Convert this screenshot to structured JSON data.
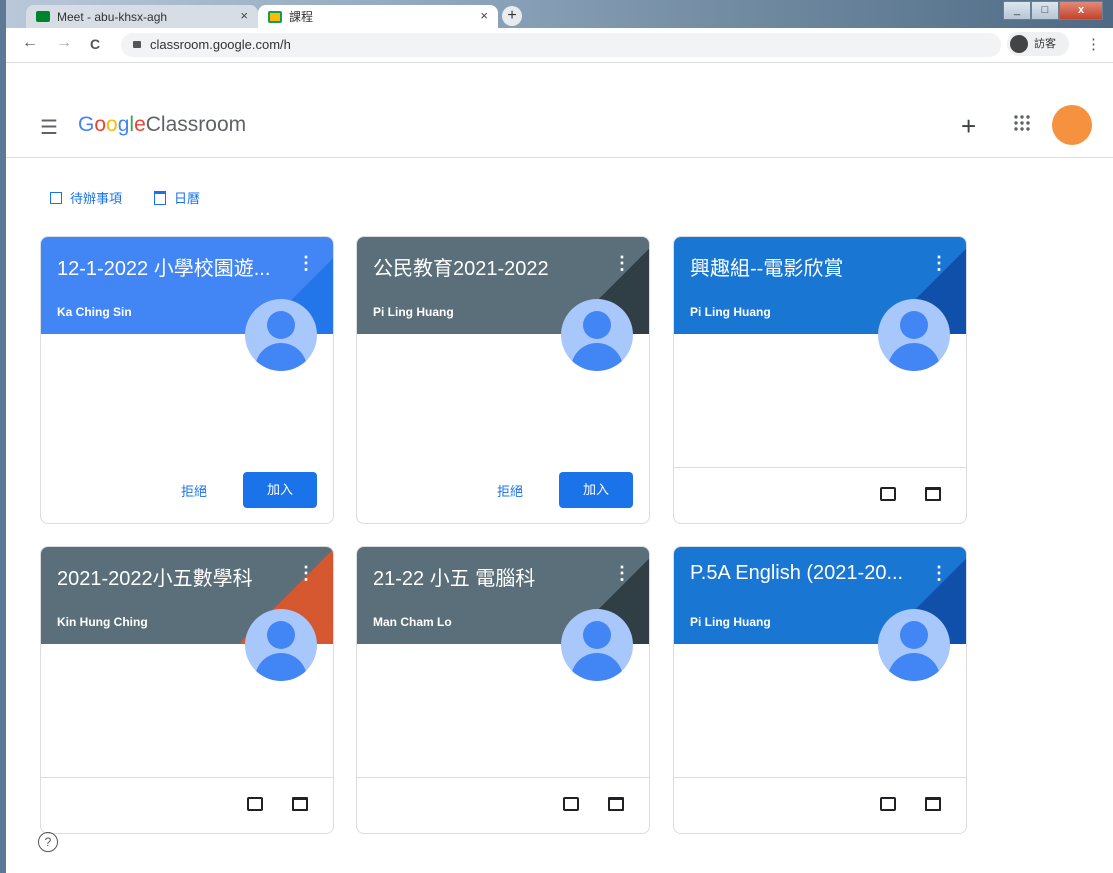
{
  "browser": {
    "tabs": [
      {
        "title": "Meet - abu-khsx-agh",
        "close": "×"
      },
      {
        "title": "課程",
        "close": "×"
      }
    ],
    "new_tab": "+",
    "window_buttons": [
      "_",
      "□",
      "x"
    ],
    "nav": {
      "back": "←",
      "forward": "→",
      "reload": "C"
    },
    "url": "classroom.google.com/h",
    "profile_label": "訪客",
    "menu": "⋮"
  },
  "app": {
    "menu_icon": "☰",
    "logo_google": [
      "G",
      "o",
      "o",
      "g",
      "l",
      "e"
    ],
    "logo_colors": [
      "#4285f4",
      "#ea4335",
      "#fbbc05",
      "#4285f4",
      "#34a853",
      "#ea4335"
    ],
    "logo_product": "Classroom",
    "create_icon": "+",
    "apps_icon": "⋮⋮⋮",
    "avatar_color": "#f6913f"
  },
  "shortcuts": {
    "todo": "待辦事項",
    "calendar": "日曆"
  },
  "classes": [
    {
      "title": "12-1-2022 小學校園遊...",
      "teacher": "Ka Ching Sin",
      "color": "#4285f4",
      "invite": true,
      "reject": "拒絕",
      "join": "加入"
    },
    {
      "title": "公民教育2021-2022",
      "teacher": "Pi Ling Huang",
      "color": "#5b6f7a",
      "invite": true,
      "reject": "拒絕",
      "join": "加入"
    },
    {
      "title": "興趣組--電影欣賞",
      "teacher": "Pi Ling Huang",
      "color": "#1976d2",
      "invite": false
    },
    {
      "title": "2021-2022小五數學科",
      "teacher": "Kin Hung Ching",
      "color": "#5b6f7a",
      "invite": false
    },
    {
      "title": "21-22 小五 電腦科",
      "teacher": "Man Cham Lo",
      "color": "#5b6f7a",
      "invite": false
    },
    {
      "title": "P.5A English (2021-20...",
      "teacher": "Pi Ling Huang",
      "color": "#1976d2",
      "invite": false
    }
  ],
  "help": "?"
}
